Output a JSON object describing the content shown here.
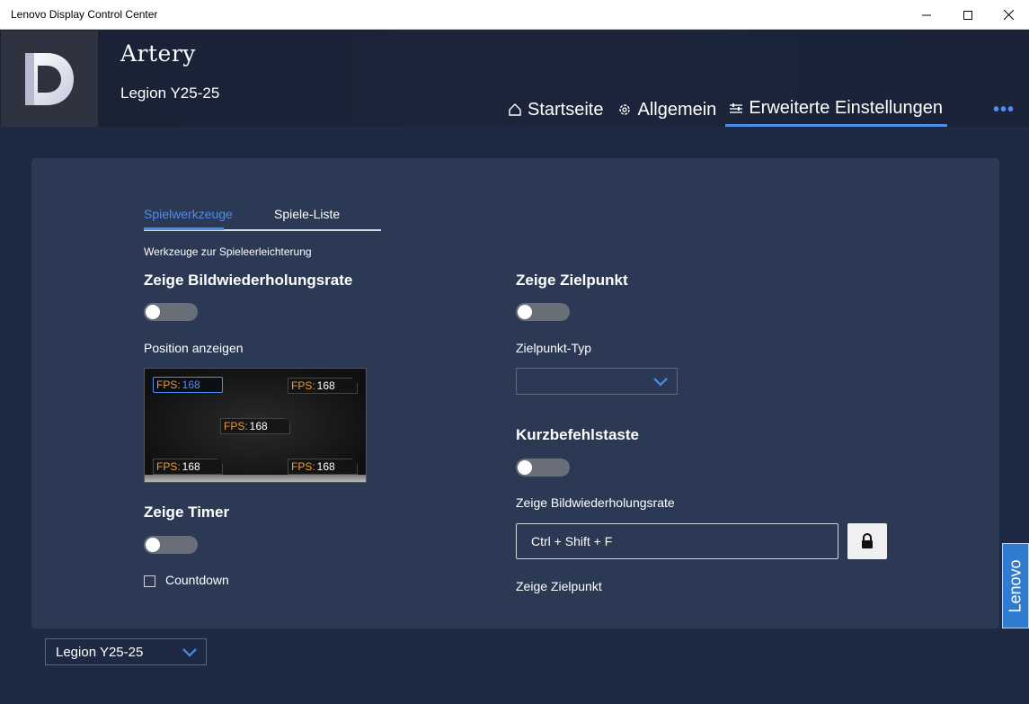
{
  "window": {
    "title": "Lenovo Display Control Center"
  },
  "header": {
    "brand": "Artery",
    "model": "Legion Y25-25",
    "nav": [
      {
        "label": "Startseite",
        "icon": "home-icon"
      },
      {
        "label": "Allgemein",
        "icon": "gear-icon"
      },
      {
        "label": "Erweiterte Einstellungen",
        "icon": "sliders-icon",
        "active": true
      }
    ],
    "more": "•••"
  },
  "panel": {
    "tabs": [
      "Spielwerkzeuge",
      "Spiele-Liste"
    ],
    "active_tab": 0,
    "subtitle": "Werkzeuge zur Spieleerleichterung",
    "left": {
      "refresh_heading": "Zeige Bildwiederholungsrate",
      "refresh_toggle": false,
      "position_label": "Position anzeigen",
      "fps_label": "FPS:",
      "fps_value": "168",
      "timer_heading": "Zeige Timer",
      "timer_toggle": false,
      "countdown_label": "Countdown",
      "countdown_checked": false
    },
    "right": {
      "crosshair_heading": "Zeige Zielpunkt",
      "crosshair_toggle": false,
      "crosshair_type_label": "Zielpunkt-Typ",
      "crosshair_type_value": "",
      "hotkey_heading": "Kurzbefehlstaste",
      "hotkey_toggle": false,
      "hotkey_refresh_label": "Zeige Bildwiederholungsrate",
      "hotkey_refresh_value": "Ctrl + Shift + F",
      "hotkey_crosshair_label": "Zeige Zielpunkt"
    }
  },
  "footer": {
    "monitor": "Legion Y25-25"
  },
  "side_tab": {
    "label": "Lenovo"
  },
  "colors": {
    "accent": "#4f8de8",
    "background": "#1e2a44",
    "panel": "#2b3955",
    "fps_label": "#f29a3a",
    "side_tab": "#2f7bd0"
  }
}
